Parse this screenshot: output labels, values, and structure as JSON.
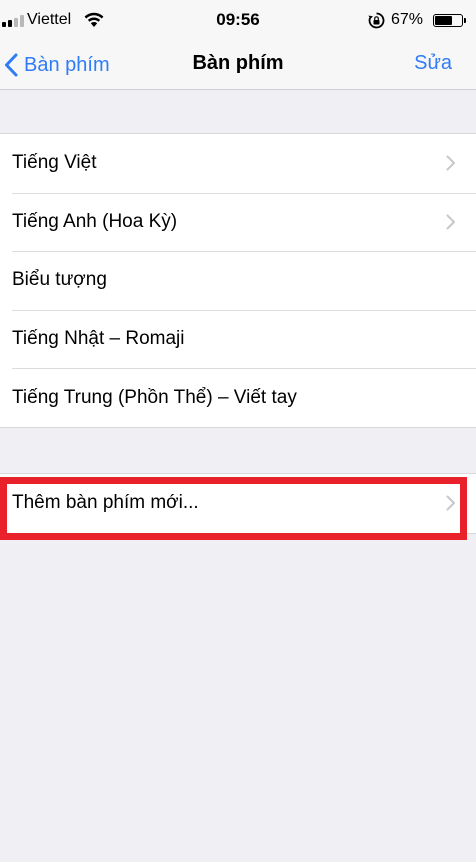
{
  "status_bar": {
    "carrier": "Viettel",
    "time": "09:56",
    "battery_percent": "67%",
    "battery_level": 0.67,
    "signal_bars_active": 2,
    "signal_bars_total": 4
  },
  "nav": {
    "back_label": "Bàn phím",
    "title": "Bàn phím",
    "edit_label": "Sửa"
  },
  "keyboards": [
    {
      "label": "Tiếng Việt",
      "has_chevron": true
    },
    {
      "label": "Tiếng Anh (Hoa Kỳ)",
      "has_chevron": true
    },
    {
      "label": "Biểu tượng",
      "has_chevron": false
    },
    {
      "label": "Tiếng Nhật – Romaji",
      "has_chevron": false
    },
    {
      "label": "Tiếng Trung (Phồn Thể) – Viết tay",
      "has_chevron": false
    }
  ],
  "add_keyboard": {
    "label": "Thêm bàn phím mới..."
  },
  "colors": {
    "accent": "#2f7cf6",
    "highlight": "#e8212b",
    "background": "#efeff4"
  },
  "icons": {
    "wifi": "wifi-icon",
    "rotation_lock": "rotation-lock-icon",
    "battery": "battery-icon",
    "back": "chevron-left-icon",
    "disclosure": "chevron-right-icon"
  }
}
